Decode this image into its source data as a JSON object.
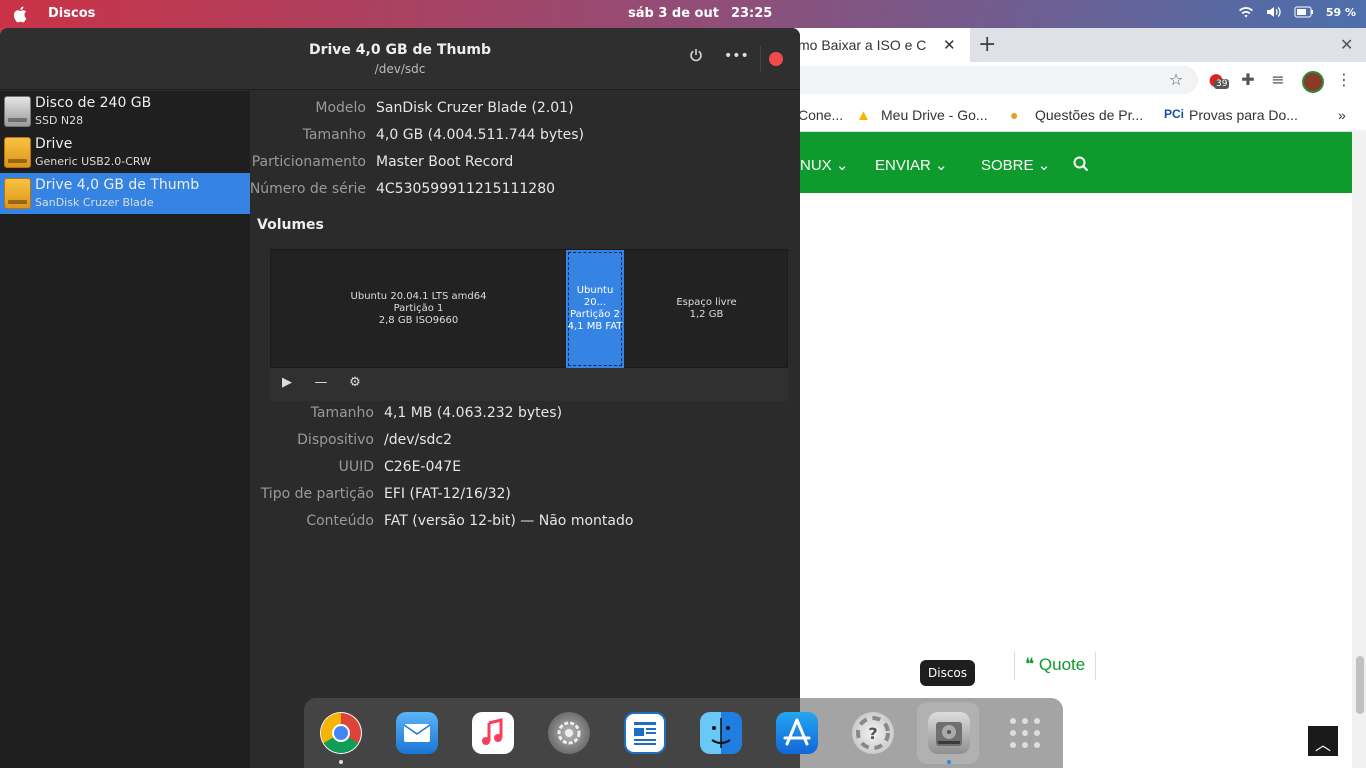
{
  "topbar": {
    "app_name": "Discos",
    "date": "sáb 3 de out",
    "time": "23:25",
    "battery": "59 %"
  },
  "browser": {
    "tab_title": "mo Baixar a ISO e C",
    "notification_count": "39",
    "bookmarks": [
      "Cone...",
      "Meu Drive - Go...",
      "Questões de Pr...",
      "Provas para Do..."
    ],
    "bookmark_prefix": "PCi",
    "nav": [
      "NUX",
      "ENVIAR",
      "SOBRE"
    ],
    "quote_label": "Quote",
    "scroll_up_icon": "chevron-up-icon"
  },
  "dock_tooltip": "Discos",
  "disks": {
    "title": "Drive 4,0 GB de Thumb",
    "subtitle": "/dev/sdc",
    "drives": [
      {
        "name": "Disco de 240 GB",
        "desc": "SSD N28",
        "icon": "hdd"
      },
      {
        "name": "Drive",
        "desc": "Generic USB2.0-CRW",
        "icon": "usb"
      },
      {
        "name": "Drive 4,0 GB de Thumb",
        "desc": "SanDisk Cruzer Blade",
        "icon": "usb"
      }
    ],
    "drive_props": [
      {
        "label": "Modelo",
        "value": "SanDisk Cruzer Blade (2.01)"
      },
      {
        "label": "Tamanho",
        "value": "4,0 GB (4.004.511.744 bytes)"
      },
      {
        "label": "Particionamento",
        "value": "Master Boot Record"
      },
      {
        "label": "Número de série",
        "value": "4C530599911215111280"
      }
    ],
    "volumes_title": "Volumes",
    "volumes": [
      {
        "line1": "Ubuntu 20.04.1 LTS amd64",
        "line2": "Partição 1",
        "line3": "2,8 GB ISO9660"
      },
      {
        "line1": "Ubuntu 20...",
        "line2": "Partição 2",
        "line3": "4,1 MB FAT"
      },
      {
        "line1": "Espaço livre",
        "line2": "1,2 GB",
        "line3": ""
      }
    ],
    "volume_props": [
      {
        "label": "Tamanho",
        "value": "4,1 MB (4.063.232 bytes)"
      },
      {
        "label": "Dispositivo",
        "value": "/dev/sdc2"
      },
      {
        "label": "UUID",
        "value": "C26E-047E"
      },
      {
        "label": "Tipo de partição",
        "value": "EFI (FAT-12/16/32)"
      },
      {
        "label": "Conteúdo",
        "value": "FAT (versão 12-bit) — Não montado"
      }
    ]
  },
  "dock": [
    "Chrome",
    "Mail",
    "Music",
    "System Preferences",
    "Documents",
    "Finder",
    "App Store",
    "Help",
    "Disks",
    "Launchpad"
  ]
}
